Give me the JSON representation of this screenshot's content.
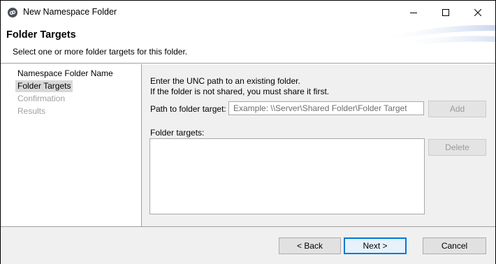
{
  "window": {
    "title": "New Namespace Folder",
    "controls": {
      "minimize": "minimize",
      "maximize": "maximize",
      "close": "close"
    }
  },
  "header": {
    "title": "Folder Targets",
    "subtitle": "Select one or more folder targets for this folder."
  },
  "steps": [
    {
      "label": "Namespace Folder Name",
      "state": "done"
    },
    {
      "label": "Folder Targets",
      "state": "current"
    },
    {
      "label": "Confirmation",
      "state": "pending"
    },
    {
      "label": "Results",
      "state": "pending"
    }
  ],
  "content": {
    "instruction_line1": "Enter the UNC path to an existing folder.",
    "instruction_line2": "If the folder is not shared, you must share it first.",
    "path_label": "Path to folder target:",
    "path_value": "",
    "path_placeholder": "Example: \\\\Server\\Shared Folder\\Folder Target",
    "add_label": "Add",
    "targets_label": "Folder targets:",
    "targets": [],
    "delete_label": "Delete"
  },
  "footer": {
    "back_label": "< Back",
    "next_label": "Next >",
    "cancel_label": "Cancel"
  },
  "colors": {
    "current_step_bg": "#d9d9d9",
    "pending_step_text": "#a0a0a0",
    "panel_bg": "#f0f0f0",
    "default_button_border": "#0078d7",
    "disabled_text": "#9a9a9a"
  }
}
